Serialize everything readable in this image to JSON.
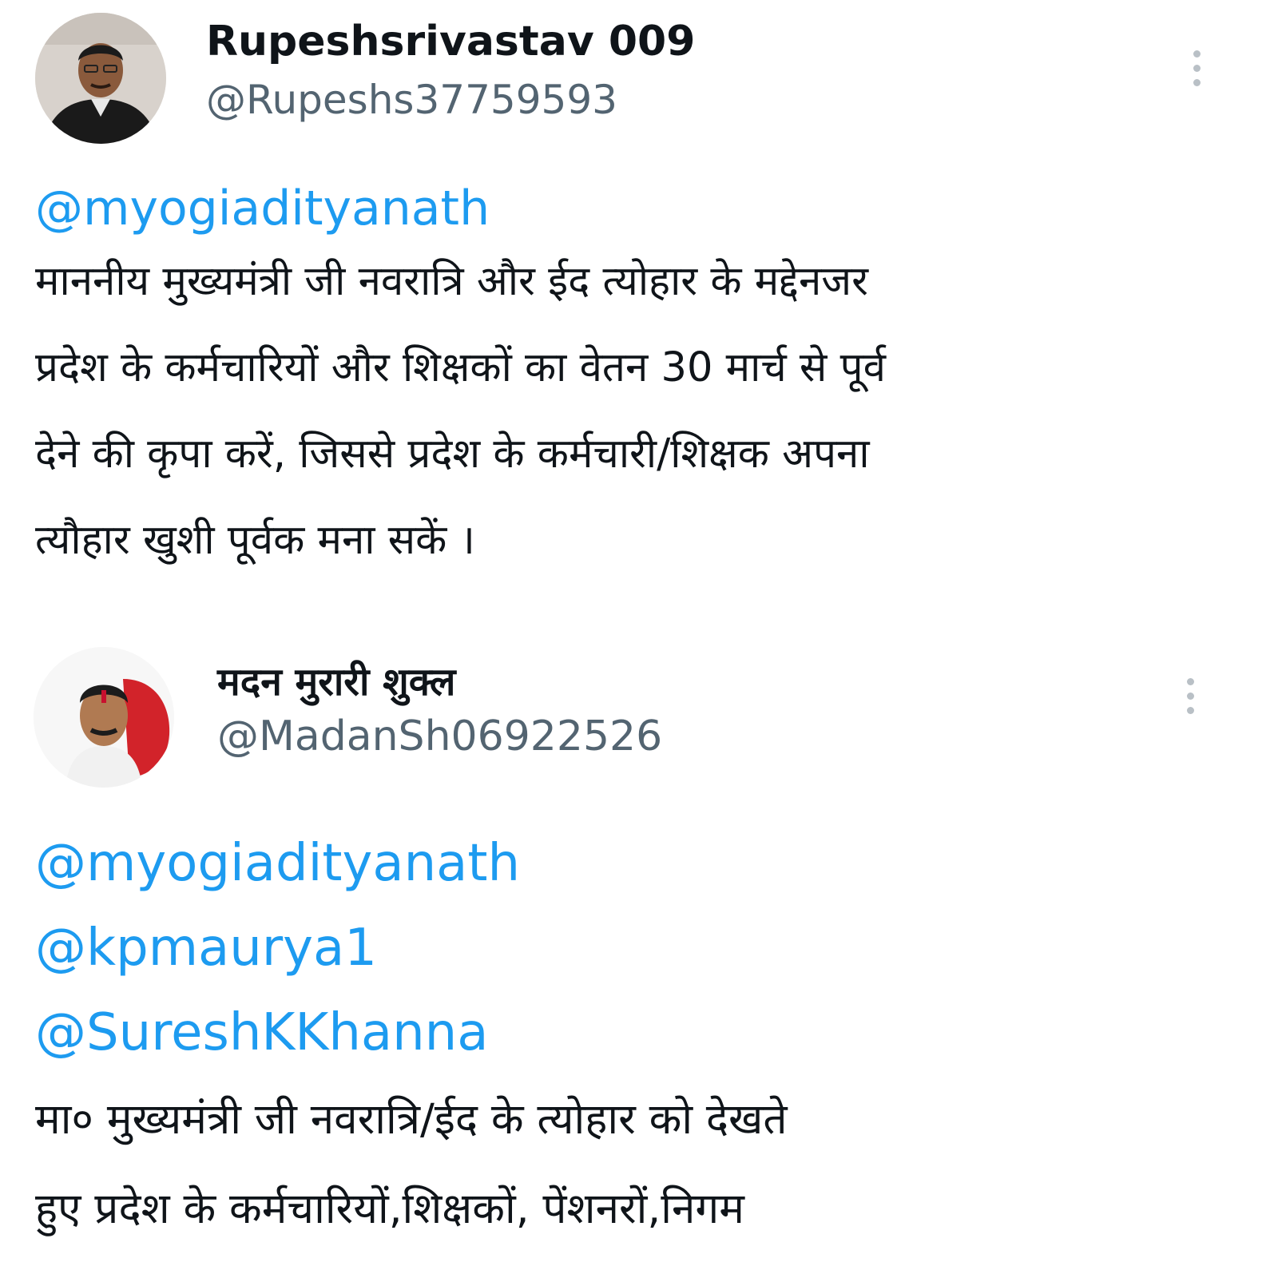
{
  "tweets": [
    {
      "display_name": "Rupeshsrivastav 009",
      "handle": "@Rupeshs37759593",
      "avatar_icon": "user-photo-avatar",
      "more_icon": "more-vertical-icon",
      "mentions": [
        "@myogiadityanath"
      ],
      "lines": [
        "माननीय मुख्यमंत्री जी नवरात्रि और ईद त्योहार के मद्देनजर",
        "प्रदेश के कर्मचारियों और शिक्षकों का वेतन 30 मार्च से पूर्व",
        "देने की कृपा करें, जिससे प्रदेश के कर्मचारी/शिक्षक अपना",
        "त्यौहार खुशी पूर्वक मना सकें ।"
      ]
    },
    {
      "display_name": "मदन मुरारी शुक्ल",
      "handle": "@MadanSh06922526",
      "avatar_icon": "user-photo-avatar",
      "more_icon": "more-vertical-icon",
      "mentions": [
        "@myogiadityanath",
        "@kpmaurya1",
        "@SureshKKhanna"
      ],
      "lines": [
        "मा० मुख्यमंत्री जी नवरात्रि/ईद के त्योहार को देखते",
        "हुए प्रदेश के कर्मचारियों,शिक्षकों,  पेंशनरों,निगम"
      ]
    }
  ],
  "colors": {
    "mention": "#1d9bf0",
    "handle": "#536471",
    "text": "#0f1419",
    "background": "#ffffff"
  }
}
